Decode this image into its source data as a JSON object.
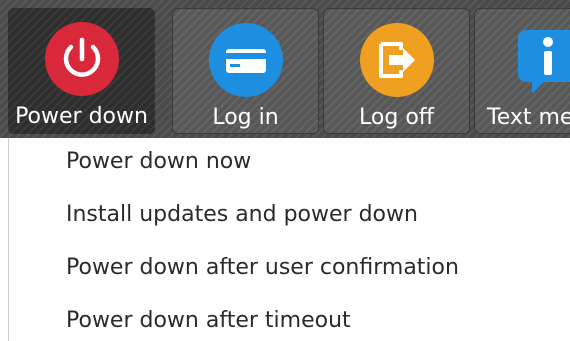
{
  "toolbar": {
    "buttons": [
      {
        "label": "Power down",
        "icon": "power-icon",
        "color": "#d9283a"
      },
      {
        "label": "Log in",
        "icon": "card-icon",
        "color": "#1e8fe0"
      },
      {
        "label": "Log off",
        "icon": "logout-arrow-icon",
        "color": "#f0a020"
      },
      {
        "label": "Text me",
        "icon": "info-icon",
        "color": "#1e8fe0"
      }
    ]
  },
  "menu": {
    "items": [
      "Power down now",
      "Install updates and power down",
      "Power down after user confirmation",
      "Power down after timeout"
    ]
  }
}
